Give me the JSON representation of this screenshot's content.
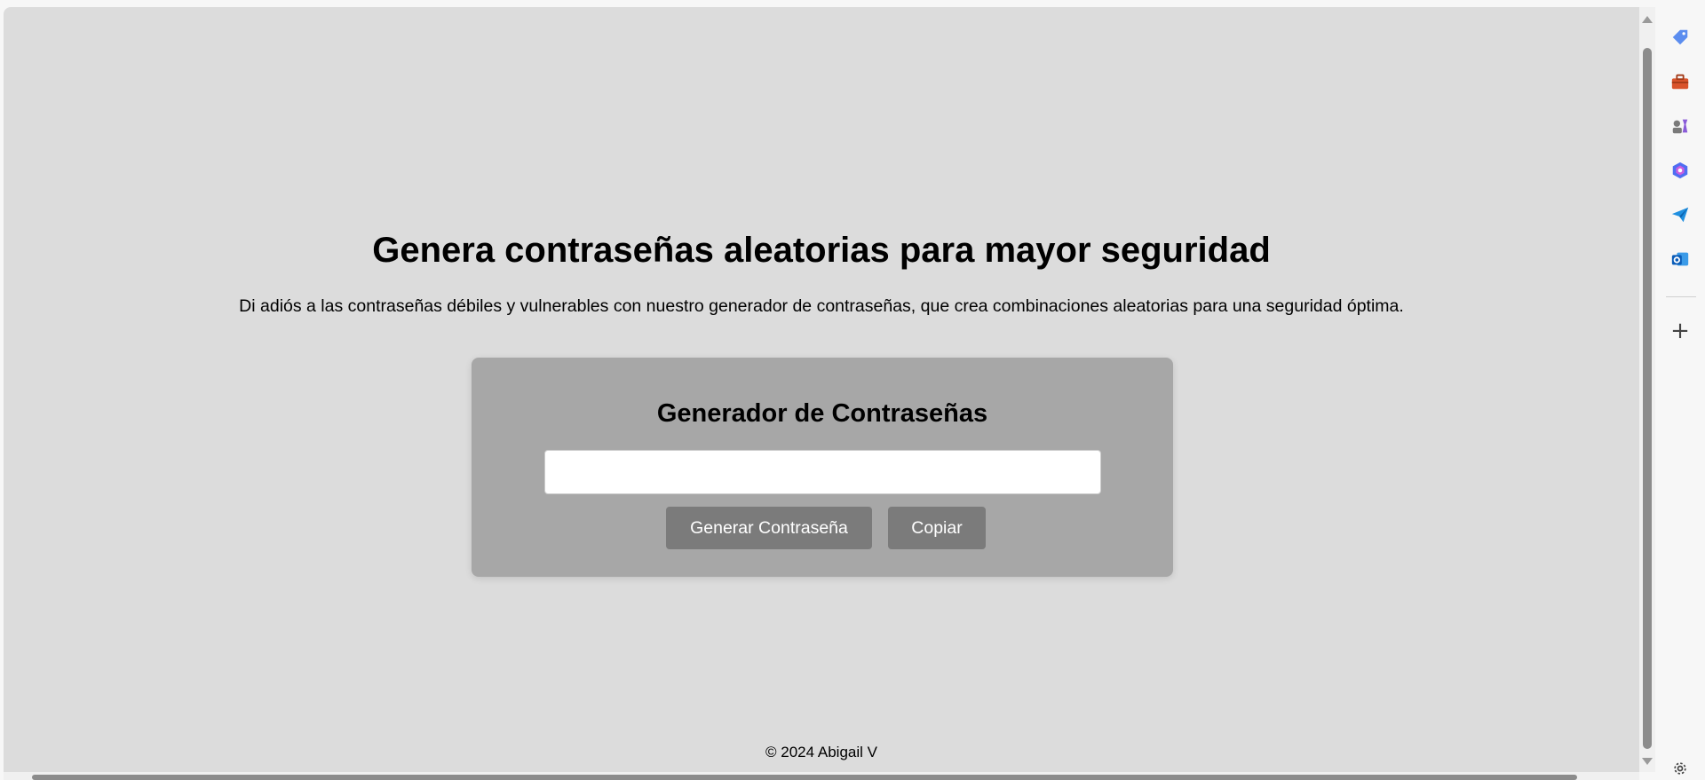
{
  "page": {
    "hero_title": "Genera contraseñas aleatorias para mayor seguridad",
    "hero_subtitle": "Di adiós a las contraseñas débiles y vulnerables con nuestro generador de contraseñas, que crea combinaciones aleatorias para una seguridad óptima."
  },
  "generator": {
    "title": "Generador de Contraseñas",
    "password_value": "",
    "generate_label": "Generar Contraseña",
    "copy_label": "Copiar"
  },
  "footer": {
    "text": "© 2024 Abigail V"
  },
  "sidebar": {
    "icons": [
      "tag-icon",
      "toolbox-icon",
      "games-icon",
      "copilot-icon",
      "send-icon",
      "outlook-icon",
      "add-icon",
      "settings-icon"
    ],
    "plus_glyph": "+"
  },
  "colors": {
    "page_background": "#dcdcdc",
    "card_background": "#a7a7a7",
    "button_background": "#7b7b7b"
  }
}
